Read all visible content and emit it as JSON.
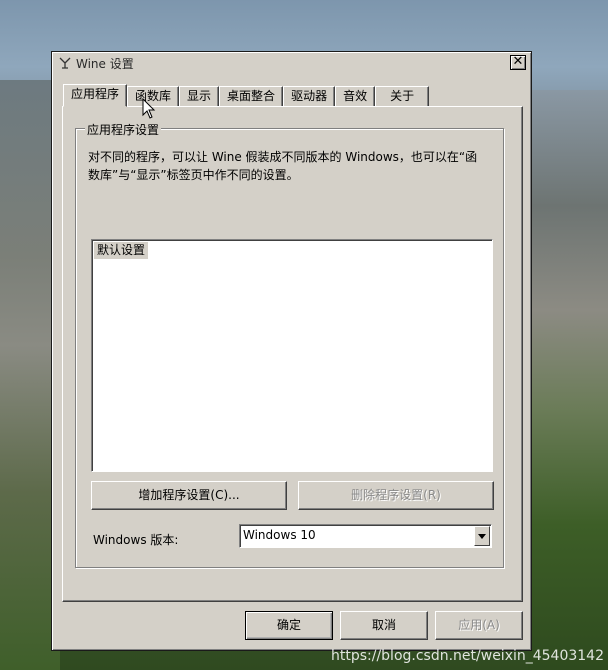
{
  "window": {
    "title": "Wine 设置",
    "close_label": "✕"
  },
  "tabs": [
    {
      "label": "应用程序",
      "active": true
    },
    {
      "label": "函数库"
    },
    {
      "label": "显示"
    },
    {
      "label": "桌面整合"
    },
    {
      "label": "驱动器"
    },
    {
      "label": "音效"
    },
    {
      "label": "关于"
    }
  ],
  "group": {
    "label": "应用程序设置",
    "description": "对不同的程序，可以让 Wine 假装成不同版本的 Windows，也可以在“函数库”与“显示”标签页中作不同的设置。"
  },
  "list": {
    "items": [
      "默认设置"
    ]
  },
  "buttons": {
    "add": "增加程序设置(C)...",
    "remove": "删除程序设置(R)",
    "ok": "确定",
    "cancel": "取消",
    "apply": "应用(A)"
  },
  "version": {
    "label": "Windows 版本:",
    "value": "Windows 10"
  },
  "watermark": "https://blog.csdn.net/weixin_45403142"
}
